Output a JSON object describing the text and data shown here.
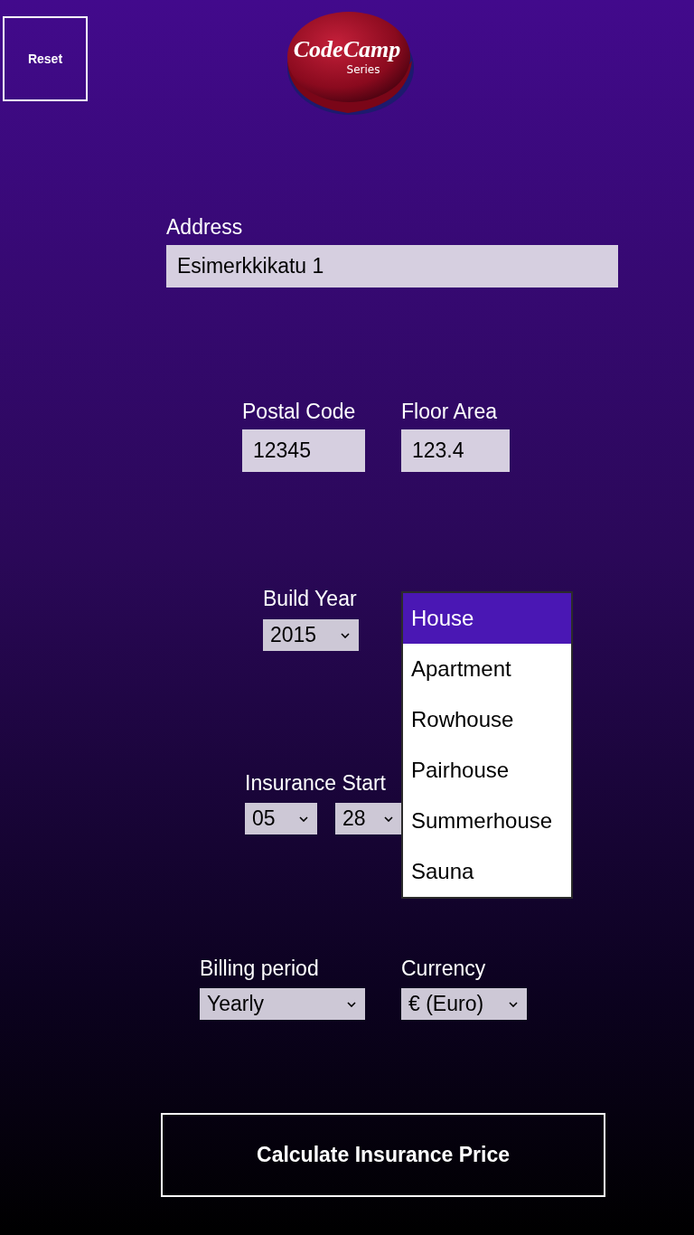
{
  "reset_button": "Reset",
  "logo": {
    "title": "CodeCamp",
    "subtitle": "Series"
  },
  "address": {
    "label": "Address",
    "value": "Esimerkkikatu 1"
  },
  "postal_code": {
    "label": "Postal Code",
    "value": "12345"
  },
  "floor_area": {
    "label": "Floor Area",
    "value": "123.4"
  },
  "build_year": {
    "label": "Build Year",
    "value": "2015"
  },
  "insurance_start": {
    "label": "Insurance Start",
    "month": "05",
    "day": "28"
  },
  "house_type_dropdown": {
    "options": [
      {
        "label": "House",
        "selected": true
      },
      {
        "label": "Apartment",
        "selected": false
      },
      {
        "label": "Rowhouse",
        "selected": false
      },
      {
        "label": "Pairhouse",
        "selected": false
      },
      {
        "label": "Summerhouse",
        "selected": false
      },
      {
        "label": "Sauna",
        "selected": false
      }
    ]
  },
  "billing_period": {
    "label": "Billing period",
    "value": "Yearly"
  },
  "currency": {
    "label": "Currency",
    "value": "€ (Euro)"
  },
  "calculate_button": "Calculate Insurance Price"
}
